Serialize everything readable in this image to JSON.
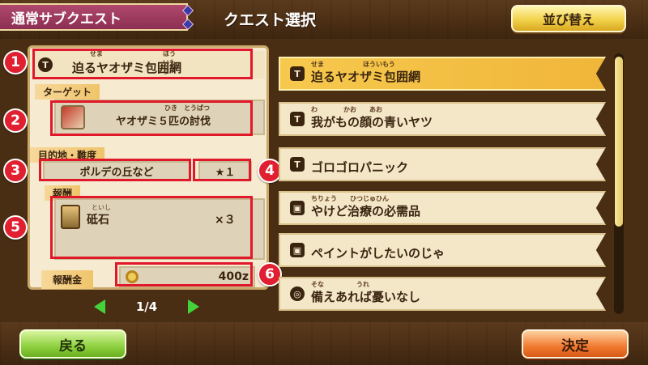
{
  "header": {
    "tab_label": "通常サブクエスト",
    "title": "クエスト選択",
    "sort_button": "並び替え"
  },
  "detail": {
    "quest_name": "迫るヤオザミ包囲網",
    "quest_name_ruby": [
      "せま",
      "ほういもう"
    ],
    "target_label": "ターゲット",
    "target_text": "ヤオザミ５匹の討伐",
    "target_ruby": [
      "ひき",
      "とうばつ"
    ],
    "destination_label": "目的地・難度",
    "destination": "ポルデの丘など",
    "difficulty": "★１",
    "reward_label": "報酬",
    "reward_item": "砥石",
    "reward_item_ruby": "といし",
    "reward_qty": "×３",
    "reward_money_label": "報酬金",
    "reward_money": "400z"
  },
  "annotations": [
    "1",
    "2",
    "3",
    "4",
    "5",
    "6"
  ],
  "quest_list": [
    {
      "name": "迫るヤオザミ包囲網",
      "ruby": "せま　　　　　　ほういもう",
      "icon": "quest-scroll-icon",
      "selected": true
    },
    {
      "name": "我がもの顔の青いヤツ",
      "ruby": "わ　　　　かお　　あお",
      "icon": "quest-scroll-icon",
      "selected": false
    },
    {
      "name": "ゴロゴロパニック",
      "ruby": "",
      "icon": "quest-scroll-icon",
      "selected": false
    },
    {
      "name": "やけど治療の必需品",
      "ruby": "ちりょう　　ひつじゅひん",
      "icon": "delivery-box-icon",
      "selected": false
    },
    {
      "name": "ペイントがしたいのじゃ",
      "ruby": "",
      "icon": "delivery-box-icon",
      "selected": false
    },
    {
      "name": "備えあれば憂いなし",
      "ruby": "そな　　　　　うれ",
      "icon": "ring-icon",
      "selected": false
    }
  ],
  "pager": {
    "indicator": "1/4"
  },
  "footer": {
    "back_button": "戻る",
    "confirm_button": "決定"
  },
  "colors": {
    "accent_red": "#e0182a",
    "selected_row": "#f6c94e",
    "tab": "#b0486c"
  }
}
